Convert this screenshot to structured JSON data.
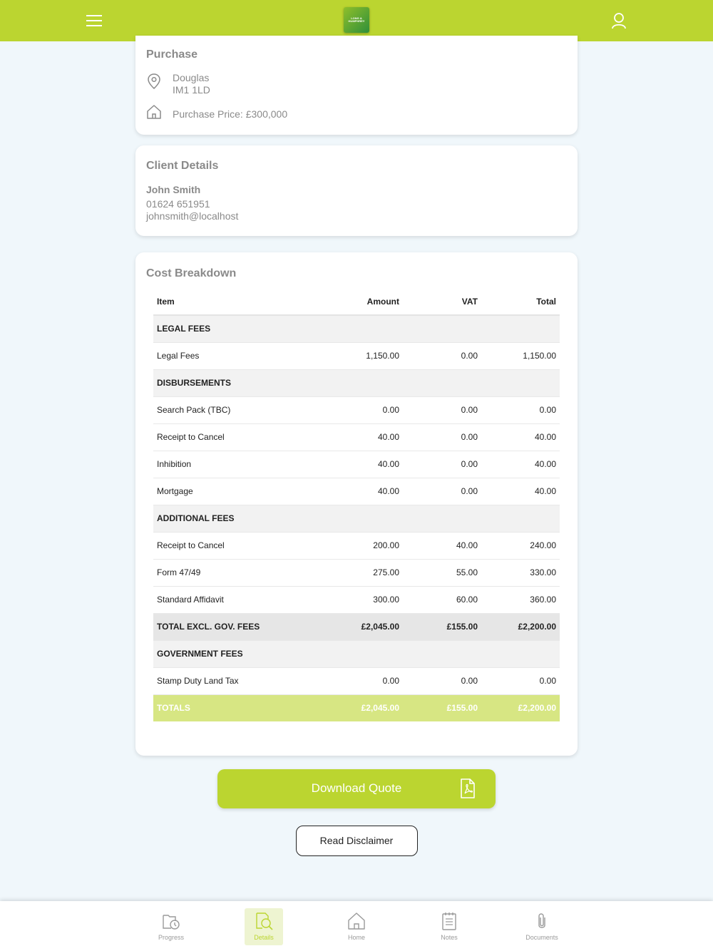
{
  "header": {
    "logo_text": "LONG & HUMPHREY",
    "icons": [
      "hamburger-icon",
      "user-icon"
    ],
    "bar_color": "#bbd530"
  },
  "purchase": {
    "title": "Purchase",
    "location_line1": "Douglas",
    "location_line2": "IM1 1LD",
    "price": "Purchase Price: £300,000"
  },
  "client": {
    "title": "Client Details",
    "name": "John Smith",
    "phone": "01624 651951",
    "email": "johnsmith@localhost"
  },
  "cost": {
    "title": "Cost Breakdown",
    "headers": {
      "item": "Item",
      "amount": "Amount",
      "vat": "VAT",
      "total": "Total"
    },
    "rows": [
      {
        "type": "section",
        "item": "LEGAL FEES",
        "amount": "",
        "vat": "",
        "total": ""
      },
      {
        "type": "row",
        "item": "Legal Fees",
        "amount": "1,150.00",
        "vat": "0.00",
        "total": "1,150.00"
      },
      {
        "type": "section",
        "item": "DISBURSEMENTS",
        "amount": "",
        "vat": "",
        "total": ""
      },
      {
        "type": "row",
        "item": "Search Pack (TBC)",
        "amount": "0.00",
        "vat": "0.00",
        "total": "0.00"
      },
      {
        "type": "row",
        "item": "Receipt to Cancel",
        "amount": "40.00",
        "vat": "0.00",
        "total": "40.00"
      },
      {
        "type": "row",
        "item": "Inhibition",
        "amount": "40.00",
        "vat": "0.00",
        "total": "40.00"
      },
      {
        "type": "row",
        "item": "Mortgage",
        "amount": "40.00",
        "vat": "0.00",
        "total": "40.00"
      },
      {
        "type": "section",
        "item": "ADDITIONAL FEES",
        "amount": "",
        "vat": "",
        "total": ""
      },
      {
        "type": "row",
        "item": "Receipt to Cancel",
        "amount": "200.00",
        "vat": "40.00",
        "total": "240.00"
      },
      {
        "type": "row",
        "item": "Form 47/49",
        "amount": "275.00",
        "vat": "55.00",
        "total": "330.00"
      },
      {
        "type": "row",
        "item": "Standard Affidavit",
        "amount": "300.00",
        "vat": "60.00",
        "total": "360.00"
      },
      {
        "type": "subtotal",
        "item": "TOTAL EXCL. GOV. FEES",
        "amount": "£2,045.00",
        "vat": "£155.00",
        "total": "£2,200.00"
      },
      {
        "type": "section",
        "item": "GOVERNMENT FEES",
        "amount": "",
        "vat": "",
        "total": ""
      },
      {
        "type": "row",
        "item": "Stamp Duty Land Tax",
        "amount": "0.00",
        "vat": "0.00",
        "total": "0.00"
      },
      {
        "type": "totals",
        "item": "TOTALS",
        "amount": "£2,045.00",
        "vat": "£155.00",
        "total": "£2,200.00"
      }
    ]
  },
  "actions": {
    "download_label": "Download Quote",
    "disclaimer_label": "Read Disclaimer"
  },
  "nav": {
    "items": [
      {
        "label": "Progress",
        "icon": "progress-icon",
        "active": false
      },
      {
        "label": "Details",
        "icon": "details-icon",
        "active": true
      },
      {
        "label": "Home",
        "icon": "home-icon",
        "active": false
      },
      {
        "label": "Notes",
        "icon": "notes-icon",
        "active": false
      },
      {
        "label": "Documents",
        "icon": "documents-icon",
        "active": false
      }
    ]
  },
  "colors": {
    "accent": "#bbd530",
    "totals_row": "#d7e683"
  }
}
